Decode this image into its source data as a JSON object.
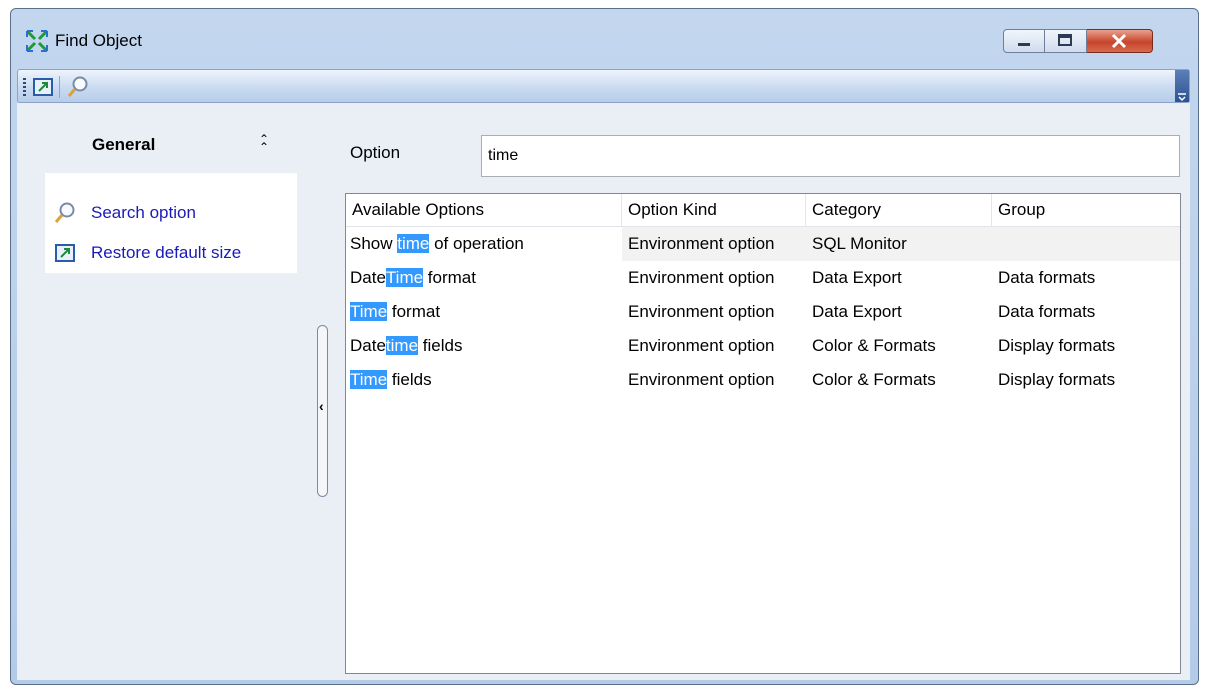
{
  "window": {
    "title": "Find Object"
  },
  "toolbar": {
    "items": [
      {
        "icon": "restore-size-icon"
      },
      {
        "icon": "search-icon"
      }
    ]
  },
  "side_panel": {
    "header": "General",
    "links": [
      {
        "label": "Search option",
        "icon": "search-icon"
      },
      {
        "label": "Restore default size",
        "icon": "restore-size-icon"
      }
    ]
  },
  "search": {
    "label": "Option",
    "value": "time"
  },
  "grid": {
    "columns": [
      "Available Options",
      "Option Kind",
      "Category",
      "Group"
    ],
    "rows": [
      {
        "option": {
          "before": "Show ",
          "match": "time",
          "after": " of operation"
        },
        "kind": "Environment option",
        "category": "SQL Monitor",
        "group": ""
      },
      {
        "option": {
          "before": "Date",
          "match": "Time",
          "after": " format"
        },
        "kind": "Environment option",
        "category": "Data Export",
        "group": "Data formats"
      },
      {
        "option": {
          "before": "",
          "match": "Time",
          "after": " format"
        },
        "kind": "Environment option",
        "category": "Data Export",
        "group": "Data formats"
      },
      {
        "option": {
          "before": "Date",
          "match": "time",
          "after": " fields"
        },
        "kind": "Environment option",
        "category": "Color & Formats",
        "group": "Display formats"
      },
      {
        "option": {
          "before": "",
          "match": "Time",
          "after": " fields"
        },
        "kind": "Environment option",
        "category": "Color & Formats",
        "group": "Display formats"
      }
    ]
  },
  "colors": {
    "highlight": "#3399ff",
    "link": "#1a1ab8",
    "close_button": "#c7442c"
  }
}
